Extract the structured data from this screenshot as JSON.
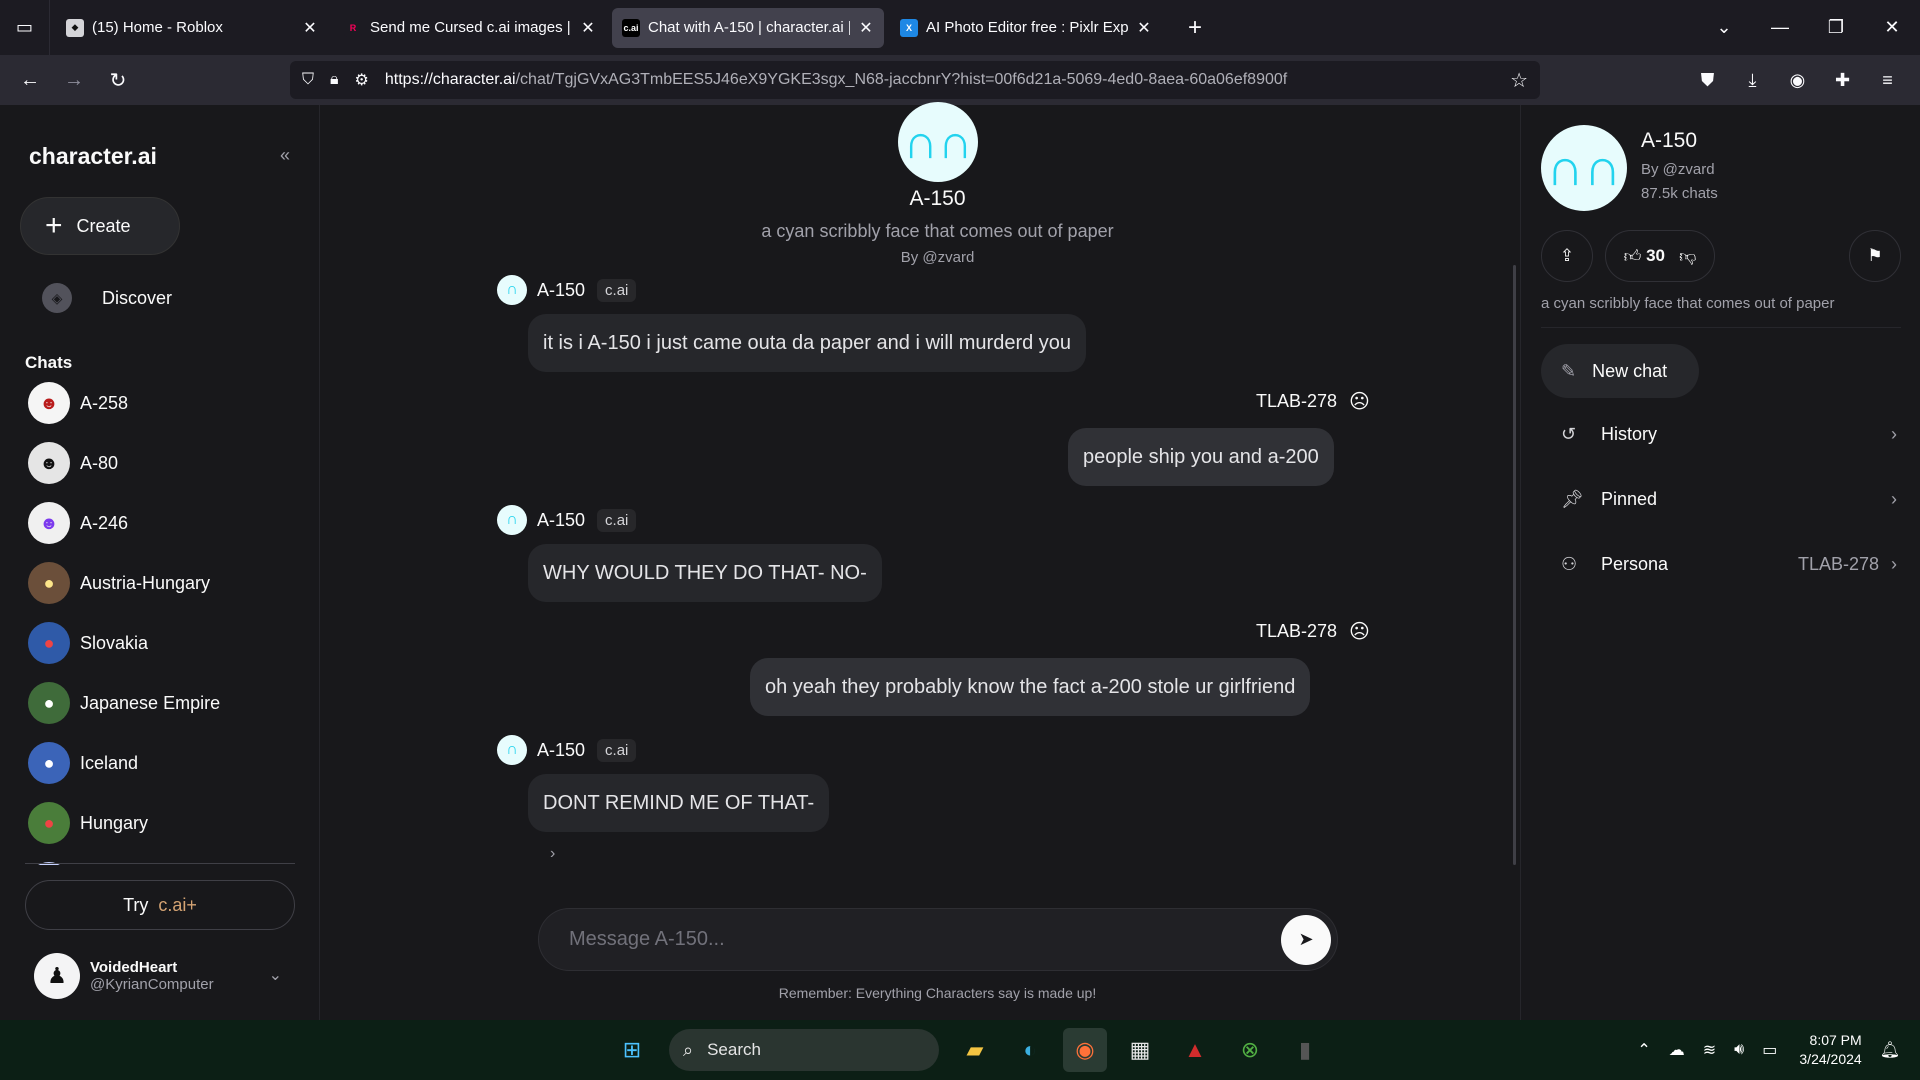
{
  "browser": {
    "tabs": [
      {
        "title": "(15) Home - Roblox",
        "favicon": "roblox-icon",
        "active": false
      },
      {
        "title": "Send me Cursed c.ai images | Fa",
        "favicon": "fandom-icon",
        "active": false
      },
      {
        "title": "Chat with A-150 | character.ai |",
        "favicon": "characterai-icon",
        "active": true
      },
      {
        "title": "AI Photo Editor free : Pixlr Expre",
        "favicon": "pixlr-icon",
        "active": false
      }
    ],
    "url_host": "https://character.ai",
    "url_path": "/chat/TgjGVxAG3TmbEES5J46eX9YGKE3sgx_N68-jaccbnrY?hist=00f6d21a-5069-4ed0-8aea-60a06ef8900f"
  },
  "sidebar": {
    "brand": "character.ai",
    "create_label": "Create",
    "discover_label": "Discover",
    "chats_heading": "Chats",
    "chats": [
      {
        "name": "A-258",
        "color": "#f5f5f5"
      },
      {
        "name": "A-80",
        "color": "#e5e5e5"
      },
      {
        "name": "A-246",
        "color": "#f0f0f0"
      },
      {
        "name": "Austria-Hungary",
        "color": "#6b4f3a"
      },
      {
        "name": "Slovakia",
        "color": "#2f5aa8"
      },
      {
        "name": "Japanese Empire",
        "color": "#3f6b3a"
      },
      {
        "name": "Iceland",
        "color": "#3b64b8"
      },
      {
        "name": "Hungary",
        "color": "#4a7d3a"
      }
    ],
    "try_label": "Try",
    "try_brand": "c.ai+",
    "user": {
      "name": "VoidedHeart",
      "handle": "@KyrianComputer"
    }
  },
  "chat": {
    "character_name": "A-150",
    "description": "a cyan scribbly face that comes out of paper",
    "author": "By @zvard",
    "messages": [
      {
        "sender": "A-150",
        "badge": "c.ai",
        "text": "it is i A-150 i just came outa da paper and i will murderd you"
      },
      {
        "sender": "TLAB-278",
        "text": "people ship you and a-200"
      },
      {
        "sender": "A-150",
        "badge": "c.ai",
        "text": "WHY WOULD THEY DO THAT- NO-"
      },
      {
        "sender": "TLAB-278",
        "text": "oh yeah they probably know the fact a-200 stole ur girlfriend"
      },
      {
        "sender": "A-150",
        "badge": "c.ai",
        "text": "DONT REMIND ME OF THAT-"
      }
    ],
    "input_placeholder": "Message A-150...",
    "disclaimer": "Remember: Everything Characters say is made up!"
  },
  "details": {
    "name": "A-150",
    "by": "By @zvard",
    "chats_count": "87.5k chats",
    "likes": "30",
    "description": "a cyan scribbly face that comes out of paper",
    "new_chat_label": "New chat",
    "history_label": "History",
    "pinned_label": "Pinned",
    "persona_label": "Persona",
    "persona_value": "TLAB-278"
  },
  "taskbar": {
    "search_label": "Search",
    "time": "8:07 PM",
    "date": "3/24/2024"
  },
  "colors": {
    "accent_cyan": "#22d3ee",
    "background": "#18181b",
    "bubble": "#26272b"
  }
}
